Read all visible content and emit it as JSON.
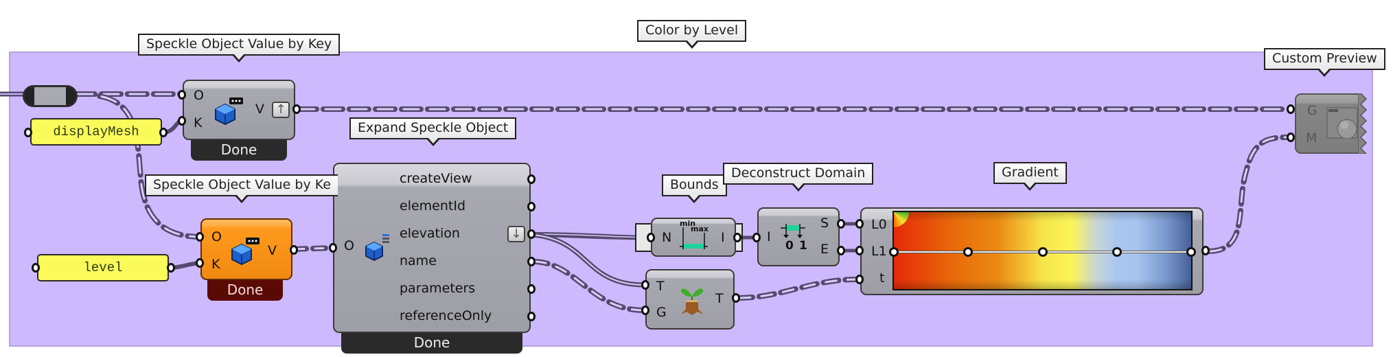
{
  "group": {
    "title": "Color by Level",
    "color": "#cdb9fe"
  },
  "relay": {
    "name": "relay"
  },
  "panels": {
    "display_mesh": "displayMesh",
    "level": "level"
  },
  "value_by_key_1": {
    "tooltip": "Speckle Object Value by Key",
    "inputs": [
      "O",
      "K"
    ],
    "output": "V",
    "status": "Done",
    "state": "normal"
  },
  "value_by_key_2": {
    "tooltip": "Speckle Object Value by Ke",
    "inputs": [
      "O",
      "K"
    ],
    "output": "V",
    "status": "Done",
    "state": "warning"
  },
  "expand": {
    "tooltip": "Expand Speckle Object",
    "input": "O",
    "outputs": [
      "createView",
      "elementId",
      "elevation",
      "name",
      "parameters",
      "referenceOnly"
    ],
    "status": "Done"
  },
  "bounds": {
    "tooltip": "Bounds",
    "input": "N",
    "output": "I",
    "icon_min": "min",
    "icon_max": "max"
  },
  "deconstruct": {
    "tooltip": "Deconstruct Domain",
    "input": "I",
    "outputs": [
      "S",
      "E"
    ],
    "icon_labels": [
      "0",
      "1"
    ]
  },
  "graft": {
    "inputs": [
      "T",
      "G"
    ],
    "output": "T"
  },
  "gradient": {
    "tooltip": "Gradient",
    "inputs": [
      "L0",
      "L1",
      "t"
    ],
    "grip_positions": [
      0,
      0.25,
      0.5,
      0.75,
      1.0
    ],
    "colors": [
      "#e52a08",
      "#eb8a12",
      "#fbf55a",
      "#a8c6f0",
      "#455f96"
    ]
  },
  "custom_preview": {
    "tooltip": "Custom Preview",
    "inputs": [
      "G",
      "M"
    ]
  },
  "wire_color": "#544a6e"
}
